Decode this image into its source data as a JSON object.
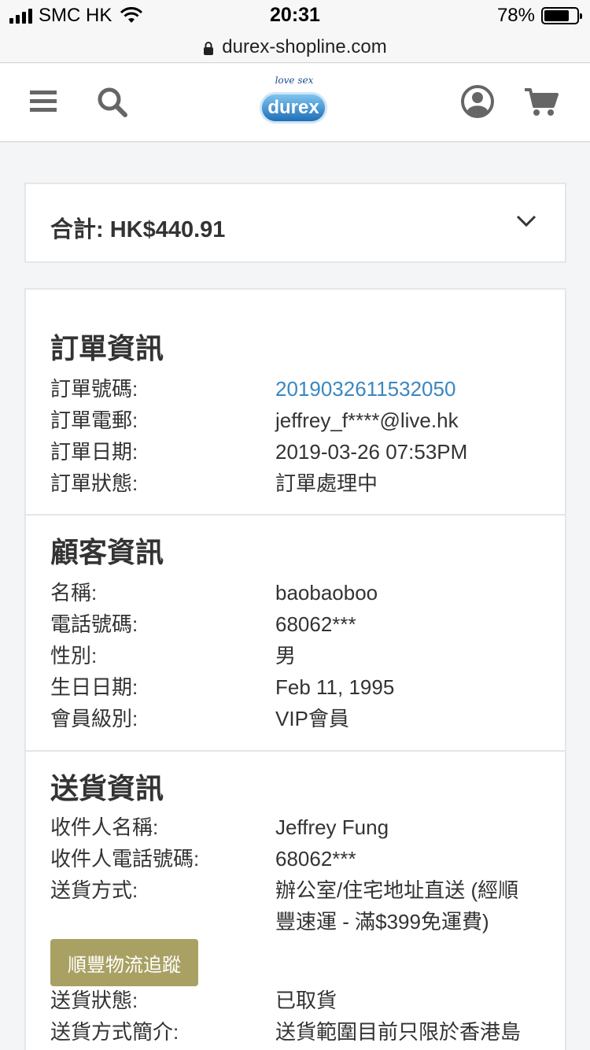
{
  "status_bar": {
    "carrier": "SMC HK",
    "time": "20:31",
    "battery": "78%",
    "battery_level": 0.78
  },
  "browser": {
    "url": "durex-shopline.com"
  },
  "header": {
    "logo_tagline": "love sex",
    "logo_text": "durex",
    "icons": [
      "menu-icon",
      "search-icon",
      "account-icon",
      "cart-icon"
    ]
  },
  "summary": {
    "total": "合計: HK$440.91"
  },
  "order_info": {
    "title": "訂單資訊",
    "rows": [
      {
        "label": "訂單號碼:",
        "value": "2019032611532050"
      },
      {
        "label": "訂單電郵:",
        "value": "jeffrey_f****@live.hk"
      },
      {
        "label": "訂單日期:",
        "value": "2019-03-26 07:53PM"
      },
      {
        "label": "訂單狀態:",
        "value": "訂單處理中"
      }
    ]
  },
  "customer_info": {
    "title": "顧客資訊",
    "rows": [
      {
        "label": "名稱:",
        "value": "baobaoboo"
      },
      {
        "label": "電話號碼:",
        "value": "68062***"
      },
      {
        "label": "性別:",
        "value": "男"
      },
      {
        "label": "生日日期:",
        "value": "Feb 11, 1995"
      },
      {
        "label": "會員級別:",
        "value": "VIP會員"
      }
    ]
  },
  "delivery_info": {
    "title": "送貨資訊",
    "rows": [
      {
        "label": "收件人名稱:",
        "value": "Jeffrey Fung"
      },
      {
        "label": "收件人電話號碼:",
        "value": "68062***"
      },
      {
        "label": "送貨方式:",
        "value": "辦公室/住宅地址直送 (經順"
      },
      {
        "label": "",
        "value": "豐速運 - 滿$399免運費)"
      }
    ],
    "track_button": "順豐物流追蹤",
    "rows_after": [
      {
        "label": "送貨狀態:",
        "value": "已取貨"
      },
      {
        "label": "送貨方式簡介:",
        "value": "送貨範圍目前只限於香港島"
      }
    ]
  },
  "colors": {
    "link": "#3a87c0",
    "button": "#a9a063"
  }
}
